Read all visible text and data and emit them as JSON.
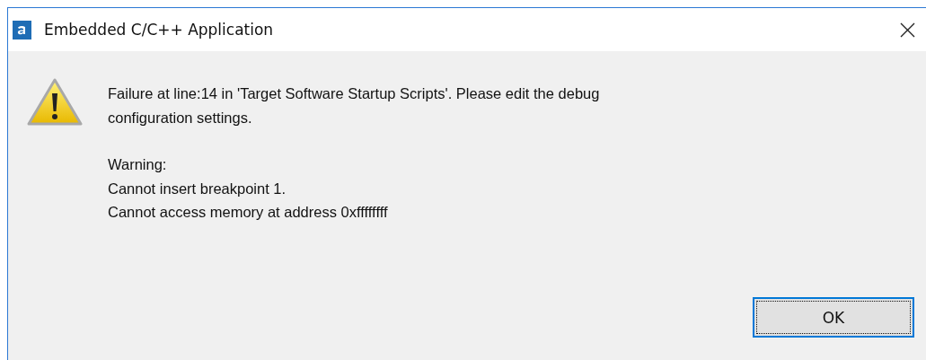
{
  "window": {
    "title": "Embedded C/C++ Application"
  },
  "message": [
    [
      "Failure at line:14 in 'Target Software Startup Scripts'. Please edit the debug",
      "configuration settings."
    ],
    [
      "Warning:",
      "Cannot insert breakpoint 1.",
      "Cannot access memory at address 0xffffffff"
    ]
  ],
  "buttons": [
    {
      "label": "OK",
      "focused": true
    }
  ]
}
